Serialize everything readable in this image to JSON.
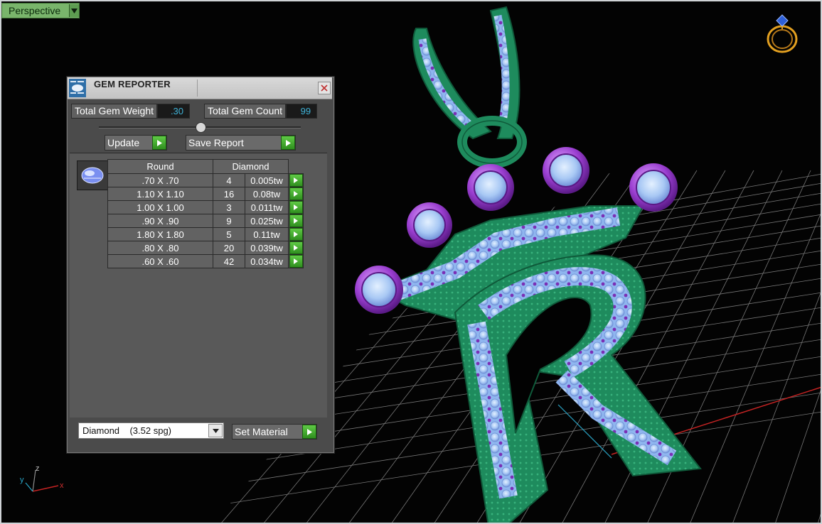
{
  "viewport": {
    "view_label": "Perspective",
    "axes": {
      "x": "x",
      "y": "y",
      "z": "z"
    }
  },
  "panel": {
    "title": "GEM REPORTER",
    "total_weight_label": "Total Gem Weight",
    "total_weight_value": ".30",
    "total_count_label": "Total Gem Count",
    "total_count_value": "99",
    "update_label": "Update",
    "save_report_label": "Save Report",
    "table": {
      "header_shape": "Round",
      "header_material": "Diamond",
      "rows": [
        {
          "size": ".70 X .70",
          "count": "4",
          "weight": "0.005tw"
        },
        {
          "size": "1.10 X 1.10",
          "count": "16",
          "weight": "0.08tw"
        },
        {
          "size": "1.00 X 1.00",
          "count": "3",
          "weight": "0.011tw"
        },
        {
          "size": ".90 X .90",
          "count": "9",
          "weight": "0.025tw"
        },
        {
          "size": "1.80 X 1.80",
          "count": "5",
          "weight": "0.11tw"
        },
        {
          "size": ".80 X .80",
          "count": "20",
          "weight": "0.039tw"
        },
        {
          "size": ".60 X .60",
          "count": "42",
          "weight": "0.034tw"
        }
      ]
    },
    "material_select_value": "Diamond    (3.52 spg)",
    "set_material_label": "Set Material"
  },
  "colors": {
    "accent_green": "#3fa52c",
    "value_cyan": "#3fb3d8",
    "metal_green": "#1f8a5e",
    "gem_blue": "#9fc4f4",
    "prong_purple": "#9b3fd1"
  }
}
